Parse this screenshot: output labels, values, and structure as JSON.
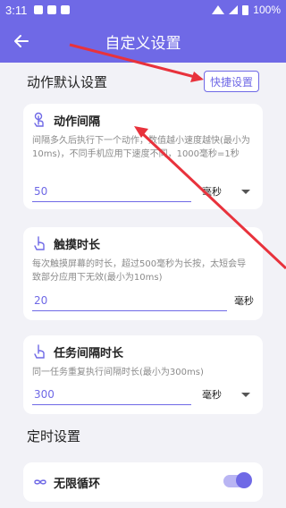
{
  "status_bar": {
    "time": "3:11",
    "battery": "100%"
  },
  "app_bar": {
    "title": "自定义设置"
  },
  "action_section": {
    "title": "动作默认设置",
    "quick_button": "快捷设置"
  },
  "cards": [
    {
      "title": "动作间隔",
      "desc": "间隔多久后执行下一个动作，数值越小速度越快(最小为10ms)，不同手机应用下速度不同，1000毫秒=1秒",
      "value": "50",
      "unit": "毫秒",
      "icon": "tap-hand-icon"
    },
    {
      "title": "触摸时长",
      "desc": "每次触摸屏幕的时长，超过500毫秒为长按，太短会导致部分应用下无效(最小为10ms)",
      "value": "20",
      "unit": "毫秒",
      "icon": "touch-hand-icon"
    },
    {
      "title": "任务间隔时长",
      "desc": "同一任务重复执行间隔时长(最小为300ms)",
      "value": "300",
      "unit": "毫秒",
      "icon": "touch-hand-icon"
    }
  ],
  "timer_section": {
    "title": "定时设置"
  },
  "loop": {
    "label": "无限循环",
    "enabled": true,
    "icon": "infinity-icon"
  },
  "colors": {
    "accent": "#6f69e6",
    "annotation_arrow": "#e8323c"
  }
}
